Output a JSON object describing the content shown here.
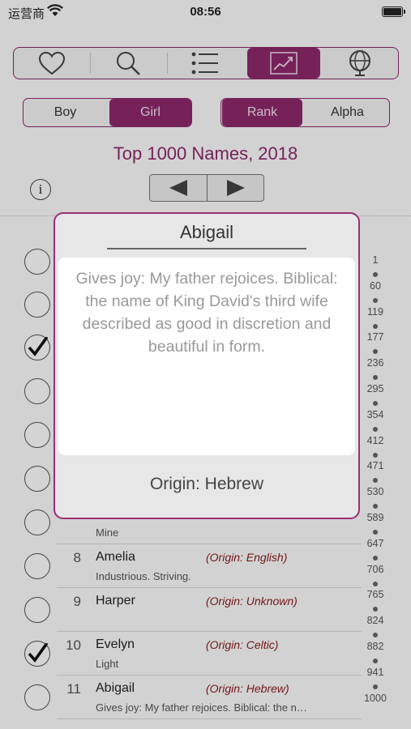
{
  "status": {
    "carrier": "运营商",
    "time": "08:56"
  },
  "colors": {
    "accent": "#8e2a6c",
    "origin_text": "#8b1a1a"
  },
  "toolbar": {
    "icons": [
      "heart-icon",
      "search-icon",
      "list-icon",
      "trend-chart-icon",
      "globe-icon"
    ],
    "active": "trend-chart-icon"
  },
  "gender": {
    "boy": "Boy",
    "girl": "Girl",
    "selected": "Girl"
  },
  "sort": {
    "rank": "Rank",
    "alpha": "Alpha",
    "selected": "Rank"
  },
  "heading": "Top 1000 Names, 2018",
  "info_glyph": "i",
  "rows": [
    {
      "num": "",
      "name": "",
      "origin": "",
      "meaning": "Mine",
      "checked": false
    },
    {
      "num": "8",
      "name": "Amelia",
      "origin": "(Origin: English)",
      "meaning": "Industrious. Striving.",
      "checked": false
    },
    {
      "num": "9",
      "name": "Harper",
      "origin": "(Origin: Unknown)",
      "meaning": "",
      "checked": false
    },
    {
      "num": "10",
      "name": "Evelyn",
      "origin": "(Origin: Celtic)",
      "meaning": "Light",
      "checked": true
    },
    {
      "num": "11",
      "name": "Abigail",
      "origin": "(Origin: Hebrew)",
      "meaning": "Gives joy: My father rejoices. Biblical: the nam…",
      "checked": false
    }
  ],
  "hidden_checks": [
    false,
    false,
    true,
    false,
    false,
    false
  ],
  "scale": [
    "1",
    "60",
    "119",
    "177",
    "236",
    "295",
    "354",
    "412",
    "471",
    "530",
    "589",
    "647",
    "706",
    "765",
    "824",
    "882",
    "941",
    "1000"
  ],
  "modal": {
    "title": "Abigail",
    "description": "Gives joy: My father rejoices. Biblical: the name of King David's third wife described as good in discretion and beautiful in form.",
    "origin": "Origin: Hebrew"
  }
}
